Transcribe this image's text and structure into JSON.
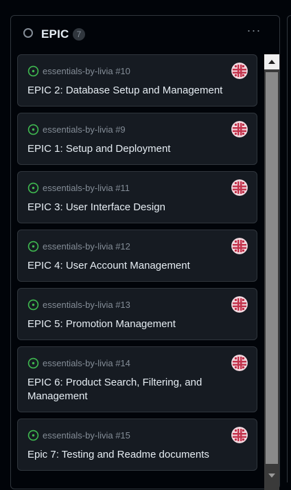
{
  "column": {
    "title": "EPIC",
    "count": "7",
    "more_label": "···"
  },
  "colors": {
    "open": "#3fb950",
    "text": "#e6edf3",
    "muted": "#848d97",
    "card_bg": "#161b22",
    "border": "#30363d",
    "avatar_red": "#c3334c"
  },
  "icons": {
    "status": "circle-icon",
    "open": "issue-opened-icon",
    "menu": "kebab-horizontal-icon",
    "avatar": "identicon-avatar"
  },
  "cards": [
    {
      "repo": "essentials-by-livia #10",
      "title": "EPIC 2: Database Setup and Management"
    },
    {
      "repo": "essentials-by-livia #9",
      "title": "EPIC 1: Setup and Deployment"
    },
    {
      "repo": "essentials-by-livia #11",
      "title": "EPIC 3: User Interface Design"
    },
    {
      "repo": "essentials-by-livia #12",
      "title": "EPIC 4: User Account Management"
    },
    {
      "repo": "essentials-by-livia #13",
      "title": "EPIC 5: Promotion Management"
    },
    {
      "repo": "essentials-by-livia #14",
      "title": "EPIC 6: Product Search, Filtering, and Management"
    },
    {
      "repo": "essentials-by-livia #15",
      "title": "Epic 7: Testing and Readme documents"
    }
  ]
}
